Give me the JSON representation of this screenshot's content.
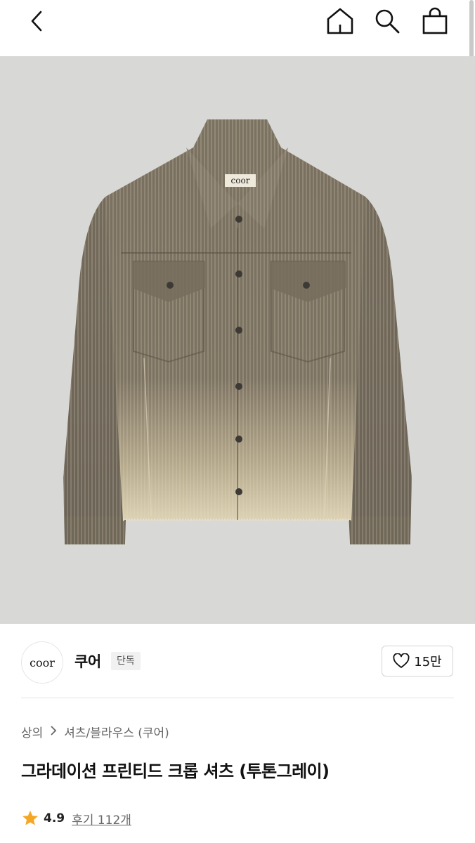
{
  "header": {
    "back_icon": "chevron-left-icon",
    "home_icon": "home-icon",
    "search_icon": "search-icon",
    "bag_icon": "shopping-bag-icon"
  },
  "product_image": {
    "label_text": "coor",
    "colors": {
      "background": "#d8d8d6",
      "fabric": "#7a7060",
      "fade": "#d9ccb0"
    }
  },
  "brand": {
    "logo_text": "coor",
    "name": "쿠어",
    "badge": "단독",
    "likes": "15만",
    "like_icon": "heart-outline-icon"
  },
  "breadcrumb": {
    "items": [
      "상의",
      "셔츠/블라우스 (쿠어)"
    ]
  },
  "product": {
    "title": "그라데이션 프린티드 크롭 셔츠 (투톤그레이)",
    "rating": "4.9",
    "reviews": "후기 112개",
    "star_color": "#f5a623"
  }
}
